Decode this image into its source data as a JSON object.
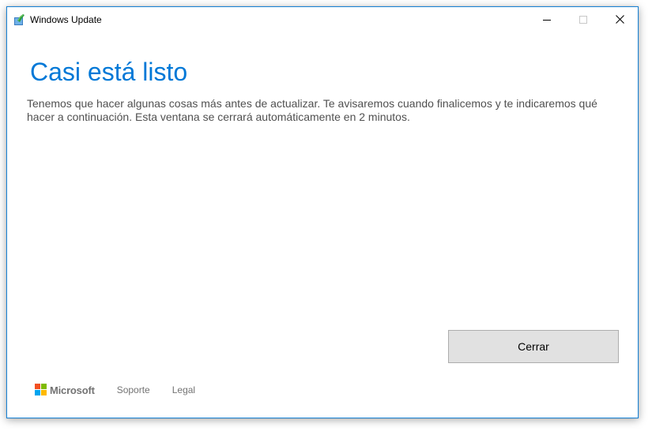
{
  "window": {
    "title": "Windows Update",
    "accent_color": "#1883d7"
  },
  "titlebar_buttons": {
    "minimize_icon": "minimize-icon",
    "maximize_icon": "maximize-icon",
    "close_icon": "close-icon"
  },
  "main": {
    "heading": "Casi está listo",
    "heading_color": "#0078d7",
    "description": "Tenemos que hacer algunas cosas más antes de actualizar. Te avisaremos cuando finalicemos y te indicaremos qué hacer a continuación. Esta ventana se cerrará automáticamente en 2 minutos.",
    "close_button_label": "Cerrar"
  },
  "footer": {
    "brand": "Microsoft",
    "brand_colors": [
      "#f25022",
      "#7fba00",
      "#00a4ef",
      "#ffb900"
    ],
    "links": [
      "Soporte",
      "Legal"
    ]
  }
}
